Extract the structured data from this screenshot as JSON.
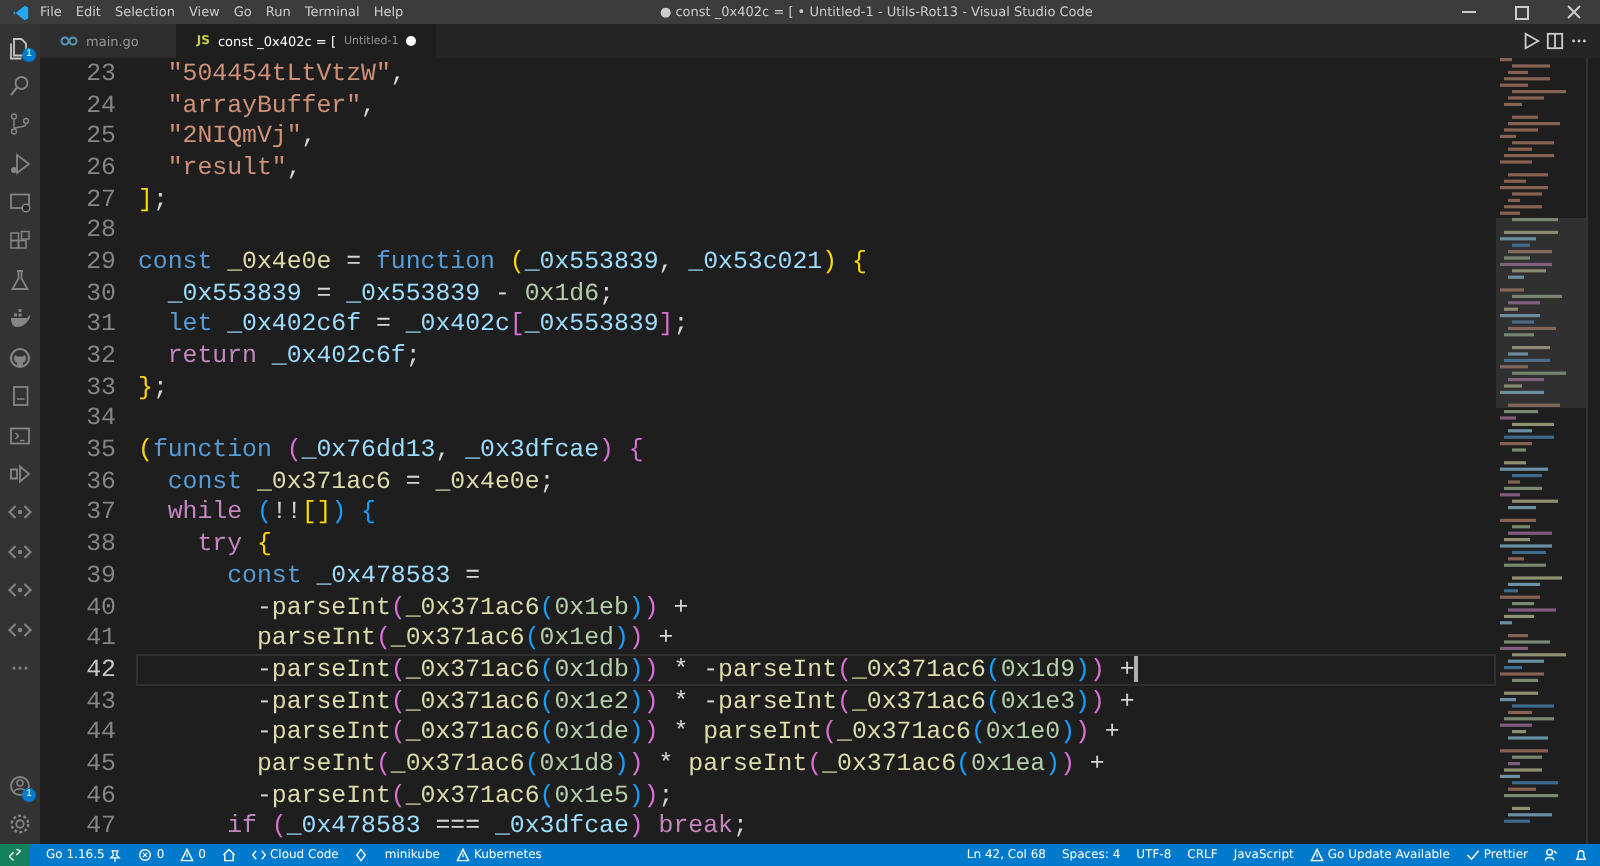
{
  "window": {
    "title": "● const _0x402c = [ • Untitled-1 - Utils-Rot13 - Visual Studio Code"
  },
  "menu": [
    "File",
    "Edit",
    "Selection",
    "View",
    "Go",
    "Run",
    "Terminal",
    "Help"
  ],
  "activity_bar": {
    "items": [
      {
        "kind": "files",
        "badge": "1"
      },
      {
        "kind": "search"
      },
      {
        "kind": "branch"
      },
      {
        "kind": "run"
      },
      {
        "kind": "monitor"
      },
      {
        "kind": "extensions"
      },
      {
        "kind": "flask"
      },
      {
        "kind": "whale"
      },
      {
        "kind": "github"
      },
      {
        "kind": "book"
      },
      {
        "kind": "terminal"
      },
      {
        "kind": "share"
      },
      {
        "kind": "code"
      },
      {
        "kind": "code"
      },
      {
        "kind": "code"
      },
      {
        "kind": "code"
      },
      {
        "kind": "more"
      }
    ],
    "bottom": [
      {
        "kind": "account",
        "badge": "1"
      },
      {
        "kind": "gear"
      }
    ]
  },
  "tabs": [
    {
      "kind": "go",
      "label": "main.go",
      "selected": false,
      "modified": false
    },
    {
      "kind": "js",
      "icon_text": "JS",
      "label": "const _0x402c = [",
      "description": "Untitled-1",
      "selected": true,
      "modified": true
    }
  ],
  "editor": {
    "lines": [
      {
        "number": "23",
        "current": false,
        "tokens": [
          {
            "kind": "string",
            "text": "  \"504454tLtVtzW\""
          },
          {
            "kind": "punct",
            "text": ","
          }
        ]
      },
      {
        "number": "24",
        "current": false,
        "tokens": [
          {
            "kind": "string",
            "text": "  \"arrayBuffer\""
          },
          {
            "kind": "punct",
            "text": ","
          }
        ]
      },
      {
        "number": "25",
        "current": false,
        "tokens": [
          {
            "kind": "string",
            "text": "  \"2NIQmVj\""
          },
          {
            "kind": "punct",
            "text": ","
          }
        ]
      },
      {
        "number": "26",
        "current": false,
        "tokens": [
          {
            "kind": "string",
            "text": "  \"result\""
          },
          {
            "kind": "punct",
            "text": ","
          }
        ]
      },
      {
        "number": "27",
        "current": false,
        "tokens": [
          {
            "kind": "bracket1",
            "text": "]"
          },
          {
            "kind": "punct",
            "text": ";"
          }
        ]
      },
      {
        "number": "28",
        "current": false
      },
      {
        "number": "29",
        "current": false,
        "tokens": [
          {
            "kind": "keyword",
            "text": "const"
          },
          {
            "kind": "function",
            "text": " _0x4e0e"
          },
          {
            "kind": "punct",
            "text": " = "
          },
          {
            "kind": "keyword",
            "text": "function"
          },
          {
            "kind": "bracket1",
            "text": " ("
          },
          {
            "kind": "variable",
            "text": "_0x553839"
          },
          {
            "kind": "punct",
            "text": ", "
          },
          {
            "kind": "variable",
            "text": "_0x53c021"
          },
          {
            "kind": "bracket1",
            "text": ")"
          },
          {
            "kind": "bracket1",
            "text": " {"
          }
        ]
      },
      {
        "number": "30",
        "current": false,
        "tokens": [
          {
            "kind": "variable",
            "text": "  _0x553839"
          },
          {
            "kind": "punct",
            "text": " = "
          },
          {
            "kind": "variable",
            "text": "_0x553839"
          },
          {
            "kind": "punct",
            "text": " - "
          },
          {
            "kind": "number",
            "text": "0x1d6"
          },
          {
            "kind": "punct",
            "text": ";"
          }
        ]
      },
      {
        "number": "31",
        "current": false,
        "tokens": [
          {
            "kind": "keyword",
            "text": "  let"
          },
          {
            "kind": "variable",
            "text": " _0x402c6f"
          },
          {
            "kind": "punct",
            "text": " = "
          },
          {
            "kind": "variable",
            "text": "_0x402c"
          },
          {
            "kind": "bracket2",
            "text": "["
          },
          {
            "kind": "variable",
            "text": "_0x553839"
          },
          {
            "kind": "bracket2",
            "text": "]"
          },
          {
            "kind": "punct",
            "text": ";"
          }
        ]
      },
      {
        "number": "32",
        "current": false,
        "tokens": [
          {
            "kind": "control",
            "text": "  return"
          },
          {
            "kind": "variable",
            "text": " _0x402c6f"
          },
          {
            "kind": "punct",
            "text": ";"
          }
        ]
      },
      {
        "number": "33",
        "current": false,
        "tokens": [
          {
            "kind": "bracket1",
            "text": "}"
          },
          {
            "kind": "punct",
            "text": ";"
          }
        ]
      },
      {
        "number": "34",
        "current": false
      },
      {
        "number": "35",
        "current": false,
        "tokens": [
          {
            "kind": "bracket1",
            "text": "("
          },
          {
            "kind": "keyword",
            "text": "function"
          },
          {
            "kind": "bracket2",
            "text": " ("
          },
          {
            "kind": "variable",
            "text": "_0x76dd13"
          },
          {
            "kind": "punct",
            "text": ", "
          },
          {
            "kind": "variable",
            "text": "_0x3dfcae"
          },
          {
            "kind": "bracket2",
            "text": ")"
          },
          {
            "kind": "bracket2",
            "text": " {"
          }
        ]
      },
      {
        "number": "36",
        "current": false,
        "tokens": [
          {
            "kind": "keyword",
            "text": "  const"
          },
          {
            "kind": "function",
            "text": " _0x371ac6"
          },
          {
            "kind": "punct",
            "text": " = "
          },
          {
            "kind": "function",
            "text": "_0x4e0e"
          },
          {
            "kind": "punct",
            "text": ";"
          }
        ]
      },
      {
        "number": "37",
        "current": false,
        "tokens": [
          {
            "kind": "control",
            "text": "  while"
          },
          {
            "kind": "bracket3",
            "text": " ("
          },
          {
            "kind": "punct",
            "text": "!!"
          },
          {
            "kind": "bracket1",
            "text": "[]"
          },
          {
            "kind": "bracket3",
            "text": ")"
          },
          {
            "kind": "bracket3",
            "text": " {"
          }
        ]
      },
      {
        "number": "38",
        "current": false,
        "tokens": [
          {
            "kind": "control",
            "text": "    try"
          },
          {
            "kind": "bracket1",
            "text": " {"
          }
        ]
      },
      {
        "number": "39",
        "current": false,
        "tokens": [
          {
            "kind": "keyword",
            "text": "      const"
          },
          {
            "kind": "variable",
            "text": " _0x478583"
          },
          {
            "kind": "punct",
            "text": " ="
          }
        ]
      },
      {
        "number": "40",
        "current": false,
        "tokens": [
          {
            "kind": "punct",
            "text": "        -"
          },
          {
            "kind": "function",
            "text": "parseInt"
          },
          {
            "kind": "bracket2",
            "text": "("
          },
          {
            "kind": "function",
            "text": "_0x371ac6"
          },
          {
            "kind": "bracket3",
            "text": "("
          },
          {
            "kind": "number",
            "text": "0x1eb"
          },
          {
            "kind": "bracket3",
            "text": ")"
          },
          {
            "kind": "bracket2",
            "text": ")"
          },
          {
            "kind": "punct",
            "text": " +"
          }
        ]
      },
      {
        "number": "41",
        "current": false,
        "tokens": [
          {
            "kind": "function",
            "text": "        parseInt"
          },
          {
            "kind": "bracket2",
            "text": "("
          },
          {
            "kind": "function",
            "text": "_0x371ac6"
          },
          {
            "kind": "bracket3",
            "text": "("
          },
          {
            "kind": "number",
            "text": "0x1ed"
          },
          {
            "kind": "bracket3",
            "text": ")"
          },
          {
            "kind": "bracket2",
            "text": ")"
          },
          {
            "kind": "punct",
            "text": " +"
          }
        ]
      },
      {
        "number": "42",
        "current": true,
        "tokens": [
          {
            "kind": "punct",
            "text": "        -"
          },
          {
            "kind": "function",
            "text": "parseInt"
          },
          {
            "kind": "bracket2",
            "text": "("
          },
          {
            "kind": "function",
            "text": "_0x371ac6"
          },
          {
            "kind": "bracket3",
            "text": "("
          },
          {
            "kind": "number",
            "text": "0x1db"
          },
          {
            "kind": "bracket3",
            "text": ")"
          },
          {
            "kind": "bracket2",
            "text": ")"
          },
          {
            "kind": "punct",
            "text": " * -"
          },
          {
            "kind": "function",
            "text": "parseInt"
          },
          {
            "kind": "bracket2",
            "text": "("
          },
          {
            "kind": "function",
            "text": "_0x371ac6"
          },
          {
            "kind": "bracket3",
            "text": "("
          },
          {
            "kind": "number",
            "text": "0x1d9"
          },
          {
            "kind": "bracket3",
            "text": ")"
          },
          {
            "kind": "bracket2",
            "text": ")"
          },
          {
            "kind": "punct",
            "text": " +"
          }
        ]
      },
      {
        "number": "43",
        "current": false,
        "tokens": [
          {
            "kind": "punct",
            "text": "        -"
          },
          {
            "kind": "function",
            "text": "parseInt"
          },
          {
            "kind": "bracket2",
            "text": "("
          },
          {
            "kind": "function",
            "text": "_0x371ac6"
          },
          {
            "kind": "bracket3",
            "text": "("
          },
          {
            "kind": "number",
            "text": "0x1e2"
          },
          {
            "kind": "bracket3",
            "text": ")"
          },
          {
            "kind": "bracket2",
            "text": ")"
          },
          {
            "kind": "punct",
            "text": " * -"
          },
          {
            "kind": "function",
            "text": "parseInt"
          },
          {
            "kind": "bracket2",
            "text": "("
          },
          {
            "kind": "function",
            "text": "_0x371ac6"
          },
          {
            "kind": "bracket3",
            "text": "("
          },
          {
            "kind": "number",
            "text": "0x1e3"
          },
          {
            "kind": "bracket3",
            "text": ")"
          },
          {
            "kind": "bracket2",
            "text": ")"
          },
          {
            "kind": "punct",
            "text": " +"
          }
        ]
      },
      {
        "number": "44",
        "current": false,
        "tokens": [
          {
            "kind": "punct",
            "text": "        -"
          },
          {
            "kind": "function",
            "text": "parseInt"
          },
          {
            "kind": "bracket2",
            "text": "("
          },
          {
            "kind": "function",
            "text": "_0x371ac6"
          },
          {
            "kind": "bracket3",
            "text": "("
          },
          {
            "kind": "number",
            "text": "0x1de"
          },
          {
            "kind": "bracket3",
            "text": ")"
          },
          {
            "kind": "bracket2",
            "text": ")"
          },
          {
            "kind": "punct",
            "text": " *"
          },
          {
            "kind": "function",
            "text": " parseInt"
          },
          {
            "kind": "bracket2",
            "text": "("
          },
          {
            "kind": "function",
            "text": "_0x371ac6"
          },
          {
            "kind": "bracket3",
            "text": "("
          },
          {
            "kind": "number",
            "text": "0x1e0"
          },
          {
            "kind": "bracket3",
            "text": ")"
          },
          {
            "kind": "bracket2",
            "text": ")"
          },
          {
            "kind": "punct",
            "text": " +"
          }
        ]
      },
      {
        "number": "45",
        "current": false,
        "tokens": [
          {
            "kind": "function",
            "text": "        parseInt"
          },
          {
            "kind": "bracket2",
            "text": "("
          },
          {
            "kind": "function",
            "text": "_0x371ac6"
          },
          {
            "kind": "bracket3",
            "text": "("
          },
          {
            "kind": "number",
            "text": "0x1d8"
          },
          {
            "kind": "bracket3",
            "text": ")"
          },
          {
            "kind": "bracket2",
            "text": ")"
          },
          {
            "kind": "punct",
            "text": " *"
          },
          {
            "kind": "function",
            "text": " parseInt"
          },
          {
            "kind": "bracket2",
            "text": "("
          },
          {
            "kind": "function",
            "text": "_0x371ac6"
          },
          {
            "kind": "bracket3",
            "text": "("
          },
          {
            "kind": "number",
            "text": "0x1ea"
          },
          {
            "kind": "bracket3",
            "text": ")"
          },
          {
            "kind": "bracket2",
            "text": ")"
          },
          {
            "kind": "punct",
            "text": " +"
          }
        ]
      },
      {
        "number": "46",
        "current": false,
        "tokens": [
          {
            "kind": "punct",
            "text": "        -"
          },
          {
            "kind": "function",
            "text": "parseInt"
          },
          {
            "kind": "bracket2",
            "text": "("
          },
          {
            "kind": "function",
            "text": "_0x371ac6"
          },
          {
            "kind": "bracket3",
            "text": "("
          },
          {
            "kind": "number",
            "text": "0x1e5"
          },
          {
            "kind": "bracket3",
            "text": ")"
          },
          {
            "kind": "bracket2",
            "text": ")"
          },
          {
            "kind": "punct",
            "text": ";"
          }
        ]
      },
      {
        "number": "47",
        "current": false,
        "tokens": [
          {
            "kind": "control",
            "text": "      if"
          },
          {
            "kind": "bracket2",
            "text": " ("
          },
          {
            "kind": "variable",
            "text": "_0x478583"
          },
          {
            "kind": "punct",
            "text": " === "
          },
          {
            "kind": "variable",
            "text": "_0x3dfcae"
          },
          {
            "kind": "bracket2",
            "text": ")"
          },
          {
            "kind": "control",
            "text": " break"
          },
          {
            "kind": "punct",
            "text": ";"
          }
        ]
      }
    ]
  },
  "status_bar": {
    "left": [
      {
        "kind": "remote"
      },
      {
        "kind": "pin",
        "text": "Go 1.16.5"
      },
      {
        "kind": "error",
        "text": "0"
      },
      {
        "kind": "warning",
        "text": "0"
      },
      {
        "kind": "home"
      },
      {
        "kind": "code",
        "text": "Cloud Code"
      },
      {
        "kind": "diamond"
      },
      {
        "kind": "plain",
        "text": "minikube"
      },
      {
        "kind": "warning",
        "text": "Kubernetes"
      }
    ],
    "right": [
      {
        "kind": "plain",
        "text": "Ln 42, Col 68"
      },
      {
        "kind": "plain",
        "text": "Spaces: 4"
      },
      {
        "kind": "plain",
        "text": "UTF-8"
      },
      {
        "kind": "plain",
        "text": "CRLF"
      },
      {
        "kind": "plain",
        "text": "JavaScript"
      },
      {
        "kind": "warning",
        "text": "Go Update Available"
      },
      {
        "kind": "check",
        "text": "Prettier"
      },
      {
        "kind": "person"
      },
      {
        "kind": "bell"
      }
    ]
  }
}
